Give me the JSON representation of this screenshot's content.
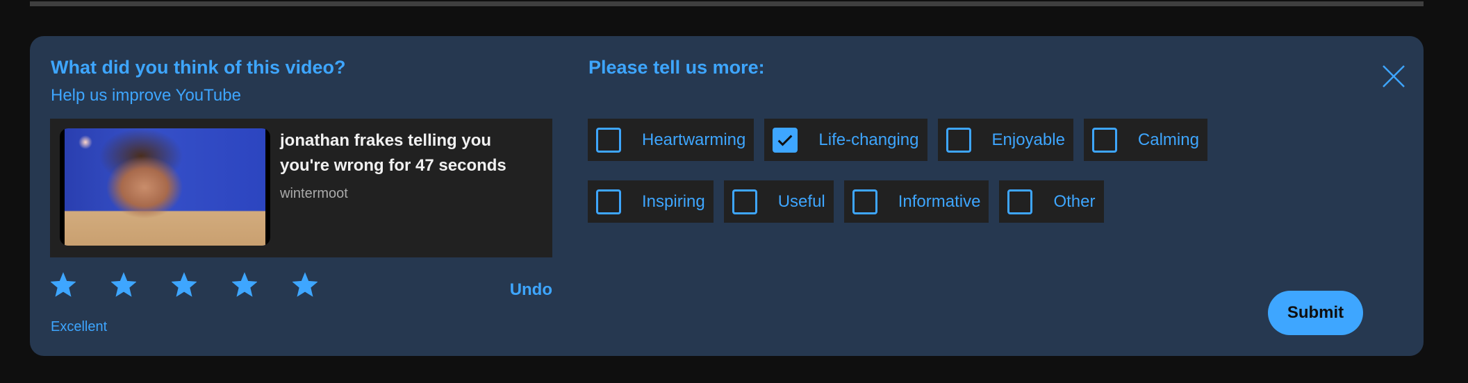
{
  "dialog": {
    "title": "What did you think of this video?",
    "subtitle": "Help us improve YouTube",
    "more_title": "Please tell us more:",
    "close_icon": "close-icon",
    "submit_label": "Submit",
    "undo_label": "Undo"
  },
  "video": {
    "title": "jonathan frakes telling you you're wrong for 47 seconds",
    "channel": "wintermoot",
    "thumbnail_icon": "video-thumbnail"
  },
  "rating": {
    "value": 5,
    "max": 5,
    "label": "Excellent",
    "star_icon": "star-icon"
  },
  "options": [
    {
      "label": "Heartwarming",
      "checked": false
    },
    {
      "label": "Life-changing",
      "checked": true
    },
    {
      "label": "Enjoyable",
      "checked": false
    },
    {
      "label": "Calming",
      "checked": false
    },
    {
      "label": "Inspiring",
      "checked": false
    },
    {
      "label": "Useful",
      "checked": false
    },
    {
      "label": "Informative",
      "checked": false
    },
    {
      "label": "Other",
      "checked": false
    }
  ],
  "colors": {
    "accent": "#3ea6ff",
    "panel_bg": "#263850",
    "card_bg": "#212121",
    "page_bg": "#0f0f0f",
    "title_text": "#f1f1f1",
    "secondary_text": "#aaaaaa"
  }
}
